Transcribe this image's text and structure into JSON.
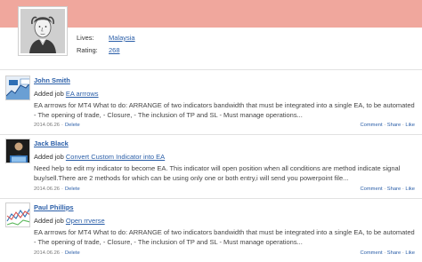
{
  "profile": {
    "lives_label": "Lives:",
    "lives_value": "Malaysia",
    "rating_label": "Rating:",
    "rating_value": "268"
  },
  "feed": [
    {
      "user": "John Smith",
      "action_prefix": "Added job",
      "job_title": "EA arrrows",
      "description": "EA arrrows for MT4 What to do: ARRANGE of two indicators bandwidth that must be integrated into a single EA, to be automated - The opening of trade, - Closure, - The inclusion of TP and SL - Must manage operations...",
      "date": "2014.06.26",
      "delete_label": "Delete",
      "comment_label": "Comment",
      "share_label": "Share",
      "like_label": "Like",
      "thumb_icon": "chart-thumbnail"
    },
    {
      "user": "Jack Black",
      "action_prefix": "Added job",
      "job_title": "Convert Custom Indicator into EA",
      "description": "Need help to edit my indicator to become  EA. This indicator will open position when all conditions are method indicate signal buy/sell.There are 2 methods for which can be using only one or both entry,i will send you powerpoint file...",
      "date": "2014.06.26",
      "delete_label": "Delete",
      "comment_label": "Comment",
      "share_label": "Share",
      "like_label": "Like",
      "thumb_icon": "person-laptop-thumbnail"
    },
    {
      "user": "Paul Phillips",
      "action_prefix": "Added job",
      "job_title": "Open rrverse",
      "description": "EA arrrows for MT4 What to do: ARRANGE of two indicators bandwidth that must be integrated into a single EA, to be automated - The opening of trade, - Closure, - The inclusion of TP and SL - Must manage operations...",
      "date": "2014.06.26",
      "delete_label": "Delete",
      "comment_label": "Comment",
      "share_label": "Share",
      "like_label": "Like",
      "thumb_icon": "line-chart-thumbnail"
    }
  ],
  "colors": {
    "banner": "#f0a79d",
    "link": "#2a5ea8"
  }
}
